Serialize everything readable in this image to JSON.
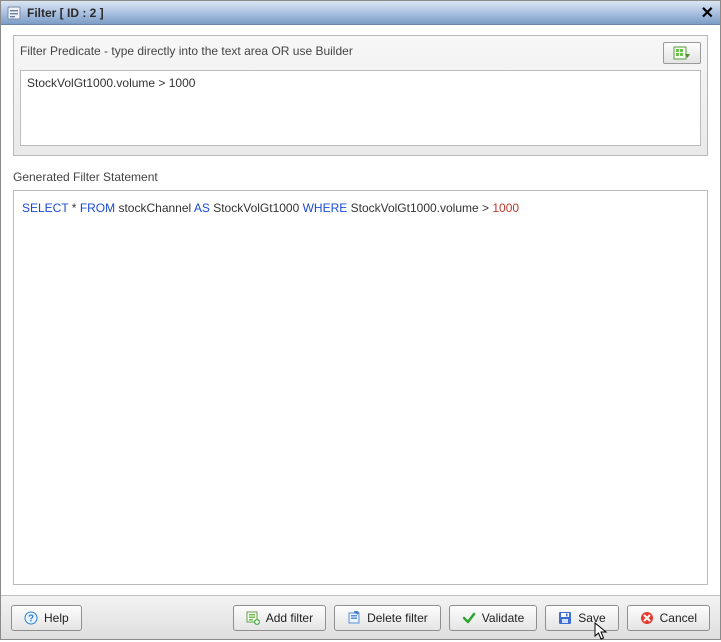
{
  "window": {
    "title": "Filter [ ID : 2 ]"
  },
  "predicate": {
    "label": "Filter Predicate - type directly into the text area OR use Builder",
    "value": "StockVolGt1000.volume > 1000"
  },
  "generated": {
    "label": "Generated Filter Statement",
    "sql": {
      "select_kw": "SELECT",
      "star_from": " * ",
      "from_kw": "FROM",
      "table": " stockChannel ",
      "as_kw": "AS",
      "alias": " StockVolGt1000 ",
      "where_kw": "WHERE",
      "cond_col": " StockVolGt1000.volume > ",
      "cond_val": "1000"
    }
  },
  "footer": {
    "help": "Help",
    "add_filter": "Add filter",
    "delete_filter": "Delete filter",
    "validate": "Validate",
    "save": "Save",
    "cancel": "Cancel"
  }
}
